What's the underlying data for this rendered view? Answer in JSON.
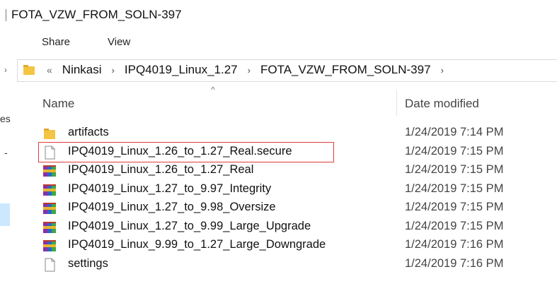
{
  "window": {
    "title": "FOTA_VZW_FROM_SOLN-397"
  },
  "ribbon": {
    "tabs": [
      {
        "label": "Share"
      },
      {
        "label": "View"
      }
    ]
  },
  "address_bar": {
    "overflow": "«",
    "crumbs": [
      {
        "label": "Ninkasi"
      },
      {
        "label": "IPQ4019_Linux_1.27"
      },
      {
        "label": "FOTA_VZW_FROM_SOLN-397"
      }
    ],
    "separator": "›"
  },
  "nav_pane": {
    "fragment_1": "es",
    "fragment_2": "-"
  },
  "columns": {
    "name": "Name",
    "date_modified": "Date modified",
    "sort_indicator": "^"
  },
  "files": [
    {
      "name": "artifacts",
      "date": "1/24/2019 7:14 PM",
      "icon": "folder-icon"
    },
    {
      "name": "IPQ4019_Linux_1.26_to_1.27_Real.secure",
      "date": "1/24/2019 7:15 PM",
      "icon": "file-icon",
      "highlighted": true
    },
    {
      "name": "IPQ4019_Linux_1.26_to_1.27_Real",
      "date": "1/24/2019 7:15 PM",
      "icon": "archive-icon"
    },
    {
      "name": "IPQ4019_Linux_1.27_to_9.97_Integrity",
      "date": "1/24/2019 7:15 PM",
      "icon": "archive-icon"
    },
    {
      "name": "IPQ4019_Linux_1.27_to_9.98_Oversize",
      "date": "1/24/2019 7:15 PM",
      "icon": "archive-icon"
    },
    {
      "name": "IPQ4019_Linux_1.27_to_9.99_Large_Upgrade",
      "date": "1/24/2019 7:15 PM",
      "icon": "archive-icon"
    },
    {
      "name": "IPQ4019_Linux_9.99_to_1.27_Large_Downgrade",
      "date": "1/24/2019 7:16 PM",
      "icon": "archive-icon"
    },
    {
      "name": "settings",
      "date": "1/24/2019 7:16 PM",
      "icon": "file-icon"
    }
  ],
  "colors": {
    "highlight_border": "#e03c3c",
    "folder": "#f4c542",
    "selection": "#cce8ff"
  }
}
